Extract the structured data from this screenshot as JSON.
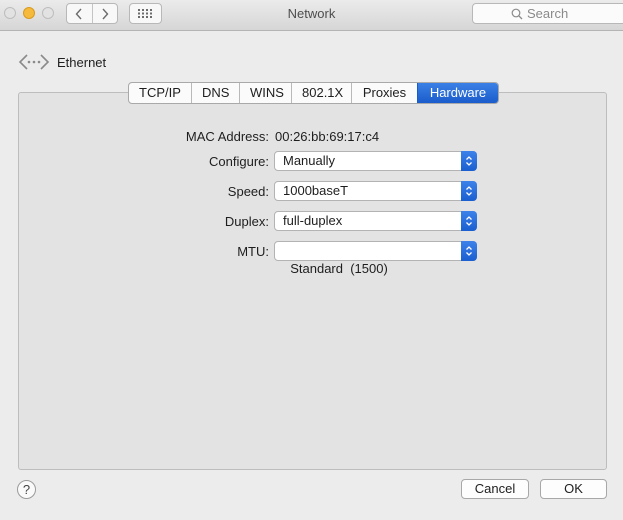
{
  "window": {
    "title": "Network"
  },
  "toolbar": {
    "back_icon": "chevron-left-icon",
    "forward_icon": "chevron-right-icon",
    "grid_icon": "show-all-grid-icon",
    "search_placeholder": "Search"
  },
  "header": {
    "interface_name": "Ethernet",
    "icon": "ethernet-icon"
  },
  "tabs": [
    {
      "label": "TCP/IP"
    },
    {
      "label": "DNS"
    },
    {
      "label": "WINS"
    },
    {
      "label": "802.1X"
    },
    {
      "label": "Proxies"
    },
    {
      "label": "Hardware",
      "selected": true
    }
  ],
  "hardware": {
    "mac_label": "MAC Address:",
    "mac_value": "00:26:bb:69:17:c4",
    "configure_label": "Configure:",
    "configure_value": "Manually",
    "speed_label": "Speed:",
    "speed_value": "1000baseT",
    "duplex_label": "Duplex:",
    "duplex_value": "full-duplex",
    "mtu_label": "MTU:",
    "mtu_value": "Standard  (1500)"
  },
  "footer": {
    "help": "?",
    "cancel": "Cancel",
    "ok": "OK"
  },
  "colors": {
    "accent": "#1a5ccb",
    "minimize": "#f5b93c",
    "window_bg": "#ececec",
    "panel_bg": "#e3e3e3"
  }
}
